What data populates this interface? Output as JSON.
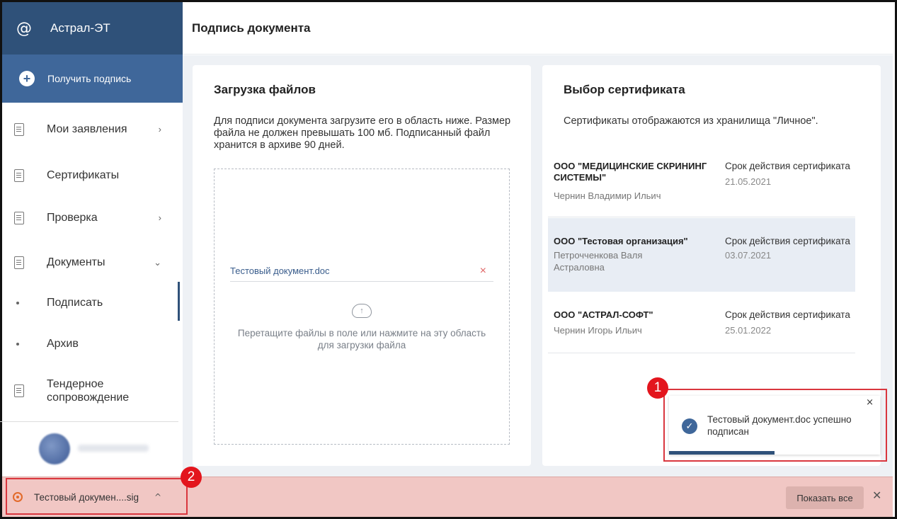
{
  "app": {
    "title": "Астрал-ЭТ"
  },
  "sidebar": {
    "get_signature": "Получить подпись",
    "items": [
      {
        "label": "Мои заявления",
        "chevron": "›"
      },
      {
        "label": "Сертификаты"
      },
      {
        "label": "Проверка",
        "chevron": "›"
      },
      {
        "label": "Документы",
        "chevron": "⌄"
      },
      {
        "label": "Подписать",
        "active": true
      },
      {
        "label": "Архив"
      },
      {
        "label": "Тендерное сопровождение"
      }
    ]
  },
  "header": {
    "title": "Подпись документа"
  },
  "upload": {
    "title": "Загрузка файлов",
    "description": "Для подписи документа загрузите его в область ниже. Размер файла не должен превышать 100 мб. Подписанный файл хранится в архиве 90 дней.",
    "file_name": "Тестовый документ.doc",
    "remove_icon": "×",
    "drop_text": "Перетащите файлы в поле или нажмите на эту область для загрузки файла"
  },
  "certificates": {
    "title": "Выбор сертификата",
    "description": "Сертификаты отображаются из хранилища \"Личное\".",
    "items": [
      {
        "org": "ООО \"МЕДИЦИНСКИЕ СКРИНИНГ СИСТЕМЫ\"",
        "person": "Чернин Владимир Ильич",
        "validity_label": "Срок действия сертификата",
        "date": "21.05.2021"
      },
      {
        "org": "ООО \"Тестовая организация\"",
        "person": "Петрочченкова Валя Астраловна",
        "validity_label": "Срок действия сертификата",
        "date": "03.07.2021",
        "selected": true
      },
      {
        "org": "ООО \"АСТРАЛ-СОФТ\"",
        "person": "Чернин Игорь Ильич",
        "validity_label": "Срок действия сертификата",
        "date": "25.01.2022"
      }
    ]
  },
  "toast": {
    "message": "Тестовый документ.doc успешно подписан",
    "close": "×",
    "check_icon": "✓",
    "progress": 0.5
  },
  "annotations": {
    "badge1": "1",
    "badge2": "2"
  },
  "download_bar": {
    "file": "Тестовый докумен....sig",
    "expand": "^",
    "show_all": "Показать все",
    "close": "✕"
  },
  "colors": {
    "brand_dark": "#2f5179",
    "brand": "#3f679a",
    "highlight": "#d9363e",
    "download_bar": "#f1c7c4"
  }
}
